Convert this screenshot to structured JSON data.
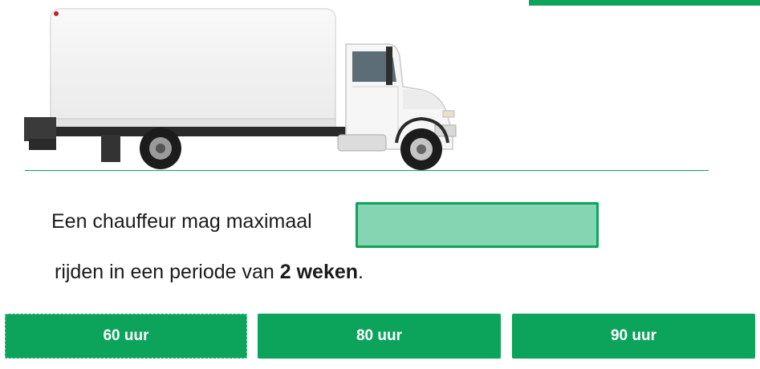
{
  "image": {
    "subject": "white box truck"
  },
  "question": {
    "prefix": "Een chauffeur mag maximaal",
    "suffix_plain": "rijden in een periode van ",
    "suffix_bold": "2 weken",
    "suffix_end": "."
  },
  "options": [
    {
      "label": "60 uur"
    },
    {
      "label": "80 uur"
    },
    {
      "label": "90 uur"
    }
  ],
  "colors": {
    "accent": "#0ca35a",
    "slot_fill": "#86d5b2"
  }
}
